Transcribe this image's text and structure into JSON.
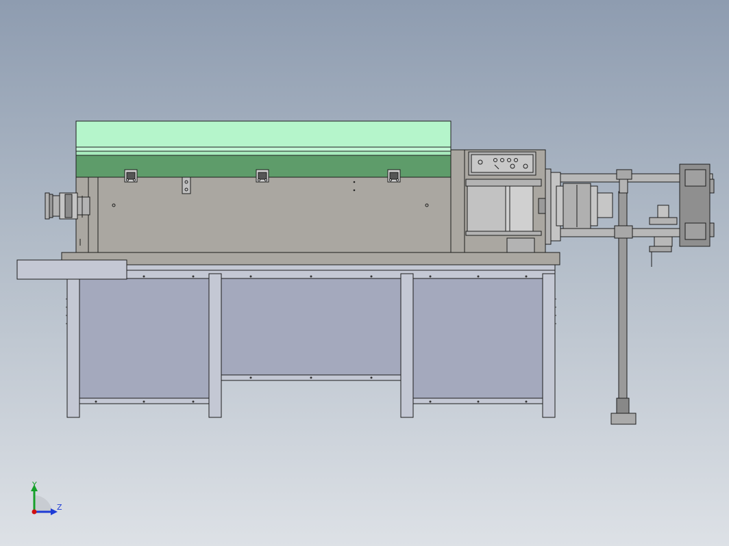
{
  "viewport": {
    "background_top": "#8e9cb0",
    "background_bottom": "#dde1e6"
  },
  "model": {
    "colors": {
      "line": "#1c1c1c",
      "body": "#aaa7a1",
      "cover_light": "#b5f5cb",
      "cover_dark": "#5e9c6a",
      "frame": "#c4c8d4",
      "frame_panel": "#a4a9bd",
      "metal": "#b3b3b3",
      "metal_dark": "#8c8c8c"
    }
  },
  "triad": {
    "y_label": "Y",
    "z_label": "Z",
    "y_color": "#16a02a",
    "z_color": "#1e3cd6",
    "origin_color": "#d01010",
    "icons": [
      "y-axis-arrow-icon",
      "z-axis-arrow-icon",
      "origin-dot-icon"
    ]
  }
}
